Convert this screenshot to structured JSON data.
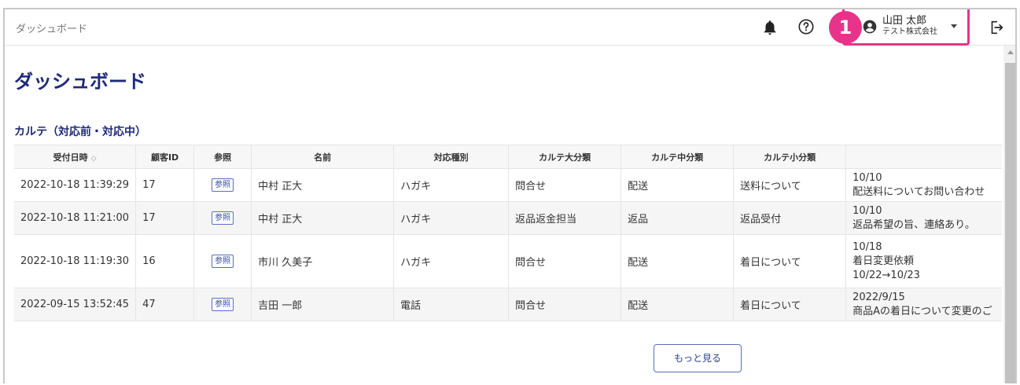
{
  "header": {
    "breadcrumb": "ダッシュボード",
    "user_name": "山田 太郎",
    "user_company": "テスト株式会社",
    "callout_number": "1",
    "bell_icon": "bell-icon",
    "help_icon": "help-circle-icon",
    "logout_icon": "logout-icon",
    "accent_color": "#e8338a"
  },
  "main": {
    "page_title": "ダッシュボード",
    "section_title": "カルテ（対応前・対応中）",
    "more_button": "もっと見る",
    "table": {
      "columns": [
        "受付日時",
        "顧客ID",
        "参照",
        "名前",
        "対応種別",
        "カルテ大分類",
        "カルテ中分類",
        "カルテ小分類",
        ""
      ],
      "sort_icon": "◇",
      "rows": [
        {
          "datetime": "2022-10-18 11:39:29",
          "customer_id": "17",
          "ref": "参照",
          "name": "中村 正大",
          "type": "ハガキ",
          "cat_large": "問合せ",
          "cat_mid": "配送",
          "cat_small": "送料について",
          "memo": [
            "10/10",
            "配送料についてお問い合わせ"
          ]
        },
        {
          "datetime": "2022-10-18 11:21:00",
          "customer_id": "17",
          "ref": "参照",
          "name": "中村 正大",
          "type": "ハガキ",
          "cat_large": "返品返金担当",
          "cat_mid": "返品",
          "cat_small": "返品受付",
          "memo": [
            "10/10",
            "返品希望の旨、連絡あり。"
          ]
        },
        {
          "datetime": "2022-10-18 11:19:30",
          "customer_id": "16",
          "ref": "参照",
          "name": "市川 久美子",
          "type": "ハガキ",
          "cat_large": "問合せ",
          "cat_mid": "配送",
          "cat_small": "着日について",
          "memo": [
            "10/18",
            "着日変更依頼",
            "10/22→10/23"
          ]
        },
        {
          "datetime": "2022-09-15 13:52:45",
          "customer_id": "47",
          "ref": "参照",
          "name": "吉田 一郎",
          "type": "電話",
          "cat_large": "問合せ",
          "cat_mid": "配送",
          "cat_small": "着日について",
          "memo": [
            "2022/9/15",
            "商品Aの着日について変更のご"
          ]
        }
      ]
    }
  }
}
